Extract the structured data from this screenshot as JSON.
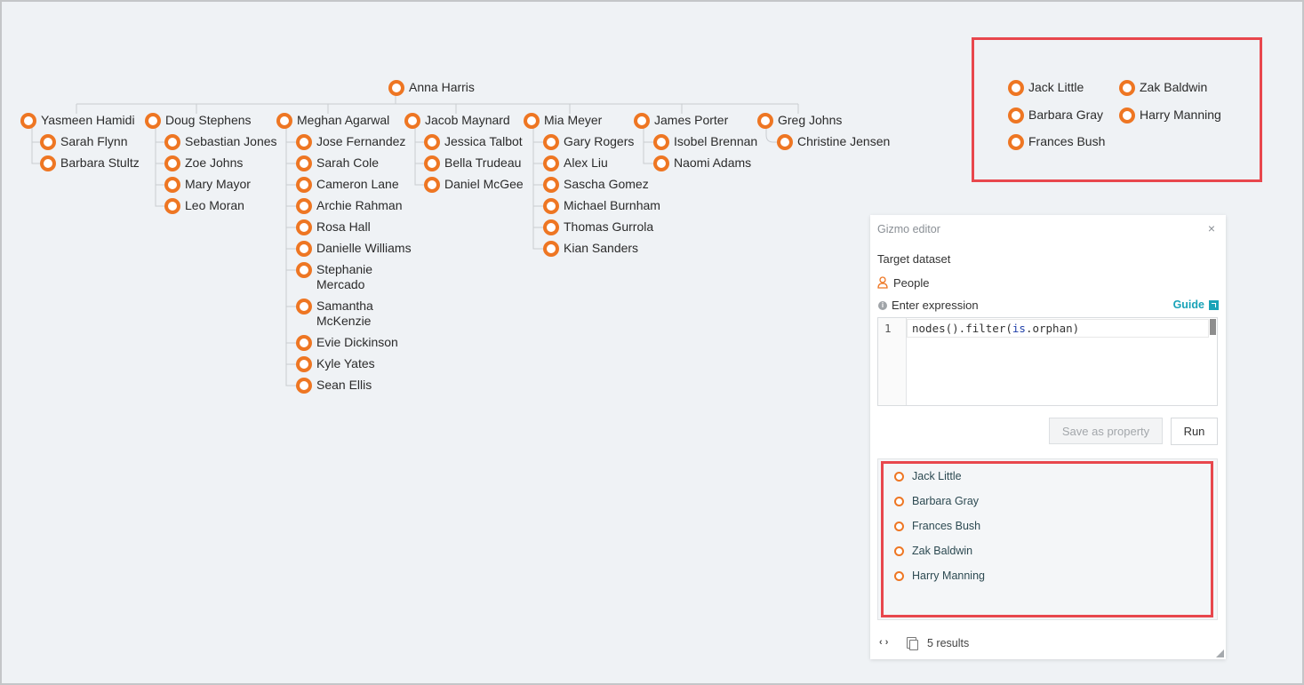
{
  "chart": {
    "root": "Anna Harris",
    "managers": [
      {
        "name": "Yasmeen Hamidi",
        "reports": [
          "Sarah Flynn",
          "Barbara Stultz"
        ]
      },
      {
        "name": "Doug Stephens",
        "reports": [
          "Sebastian Jones",
          "Zoe Johns",
          "Mary Mayor",
          "Leo Moran"
        ]
      },
      {
        "name": "Meghan Agarwal",
        "reports": [
          "Jose Fernandez",
          "Sarah Cole",
          "Cameron Lane",
          "Archie Rahman",
          "Rosa Hall",
          "Danielle Williams",
          "Stephanie Mercado",
          "Samantha McKenzie",
          "Evie Dickinson",
          "Kyle Yates",
          "Sean Ellis"
        ]
      },
      {
        "name": "Jacob Maynard",
        "reports": [
          "Jessica Talbot",
          "Bella Trudeau",
          "Daniel McGee"
        ]
      },
      {
        "name": "Mia Meyer",
        "reports": [
          "Gary Rogers",
          "Alex Liu",
          "Sascha Gomez",
          "Michael Burnham",
          "Thomas Gurrola",
          "Kian Sanders"
        ]
      },
      {
        "name": "James Porter",
        "reports": [
          "Isobel Brennan",
          "Naomi Adams"
        ]
      },
      {
        "name": "Greg Johns",
        "reports": [
          "Christine Jensen"
        ]
      }
    ],
    "orphans": [
      "Jack Little",
      "Zak Baldwin",
      "Barbara Gray",
      "Harry Manning",
      "Frances Bush"
    ]
  },
  "gizmo": {
    "title": "Gizmo editor",
    "close": "×",
    "target_label": "Target dataset",
    "dataset": "People",
    "expression_label": "Enter expression",
    "guide": "Guide",
    "line_number": "1",
    "code": {
      "part1": "nodes().filter(",
      "part2": "is",
      "part3": ".orphan)"
    },
    "save_button": "Save as property",
    "run_button": "Run",
    "results": [
      "Jack Little",
      "Barbara Gray",
      "Frances Bush",
      "Zak Baldwin",
      "Harry Manning"
    ],
    "code_icon": "‹ ›",
    "results_count": "5 results"
  },
  "icons": {
    "node": "node-dot-icon",
    "person": "person-icon",
    "info": "info-icon",
    "external": "external-link-icon",
    "code": "code-braces-icon",
    "copy": "copy-icon",
    "resize": "resize-handle-icon"
  },
  "colors": {
    "accent": "#ee7623",
    "highlight": "#e8474d",
    "link": "#1aa3b8",
    "background": "#eff2f5"
  }
}
